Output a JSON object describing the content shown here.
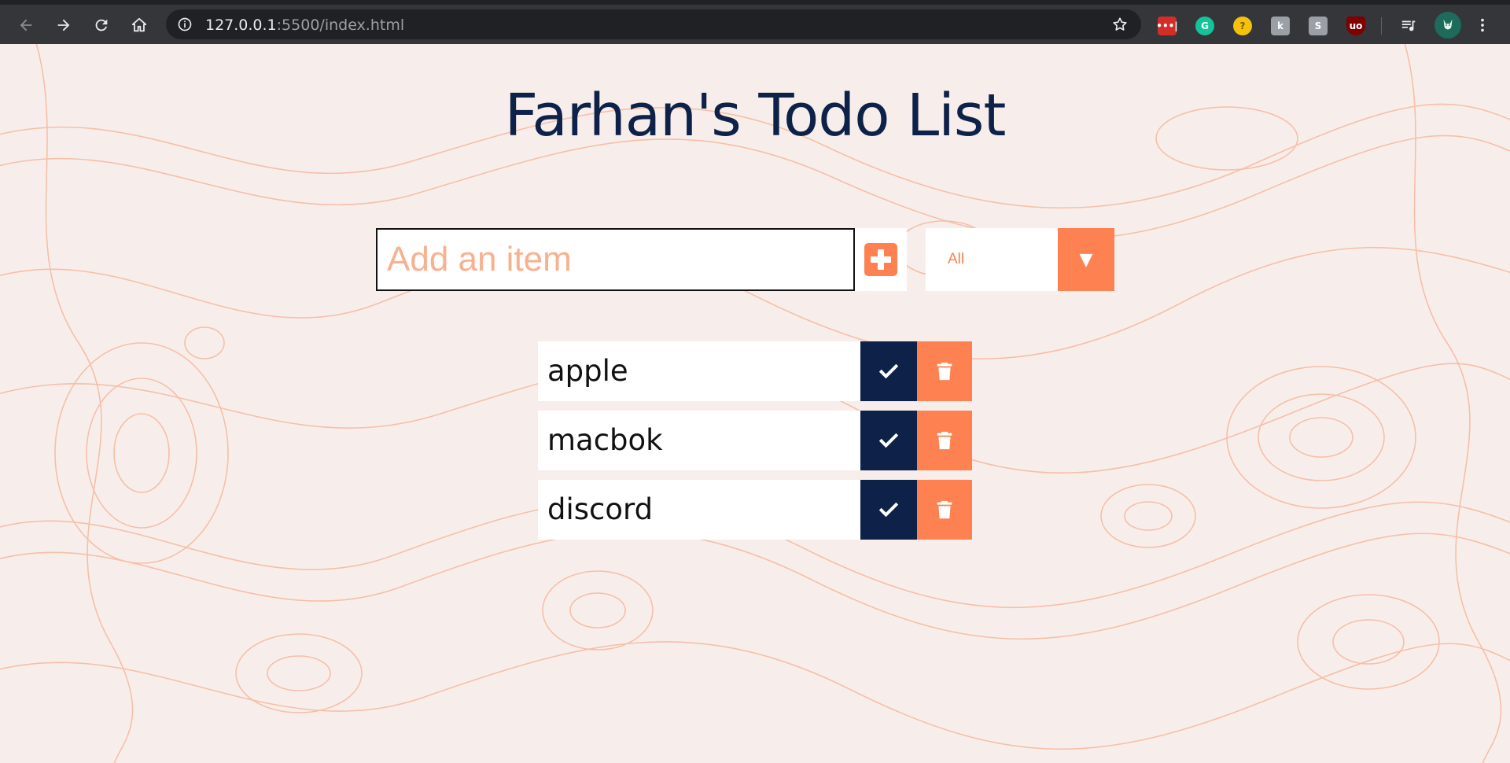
{
  "browser": {
    "url_host": "127.0.0.1",
    "url_rest": ":5500/index.html",
    "icons": [
      "back-icon",
      "forward-icon",
      "reload-icon",
      "home-icon",
      "info-icon",
      "star-icon",
      "lastpass-icon",
      "grammarly-icon",
      "extension-yellow-icon",
      "extension-k-icon",
      "extension-s-icon",
      "ublock-icon",
      "media-queue-icon",
      "profile-avatar",
      "menu-icon"
    ]
  },
  "page": {
    "title": "Farhan's Todo List",
    "input_placeholder": "Add an item",
    "filter": {
      "selected": "All"
    },
    "todos": [
      {
        "text": "apple"
      },
      {
        "text": "macbok"
      },
      {
        "text": "discord"
      }
    ]
  },
  "colors": {
    "navy": "#0e2148",
    "orange": "#fd8151",
    "background": "#f7eeeb",
    "contour": "#f6bfa8"
  }
}
